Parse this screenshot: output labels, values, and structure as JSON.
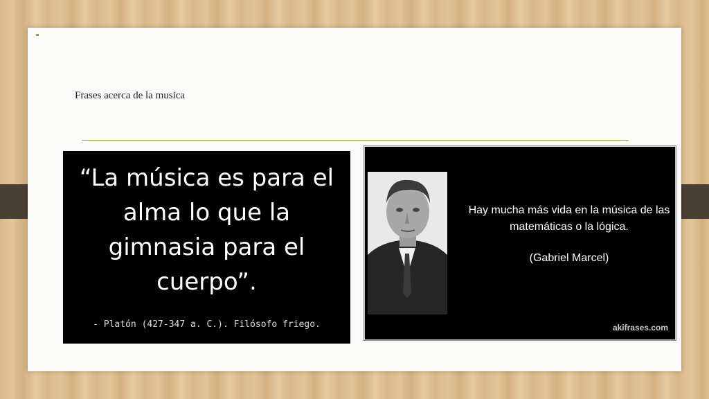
{
  "slide": {
    "title": "Frases acerca de la musica"
  },
  "quote_left": {
    "text": "“La música es para el alma lo que la gimnasia para el cuerpo”.",
    "author": "- Platón (427-347 a. C.). Filósofo friego."
  },
  "quote_image": {
    "text": "Hay mucha más vida en la música de las matemáticas o la lógica.",
    "author": "(Gabriel Marcel)",
    "watermark": "akifrases.com"
  },
  "colors": {
    "accent": "#9bb253",
    "slide_bg": "#fbfbfa",
    "quote_bg": "#000000"
  }
}
